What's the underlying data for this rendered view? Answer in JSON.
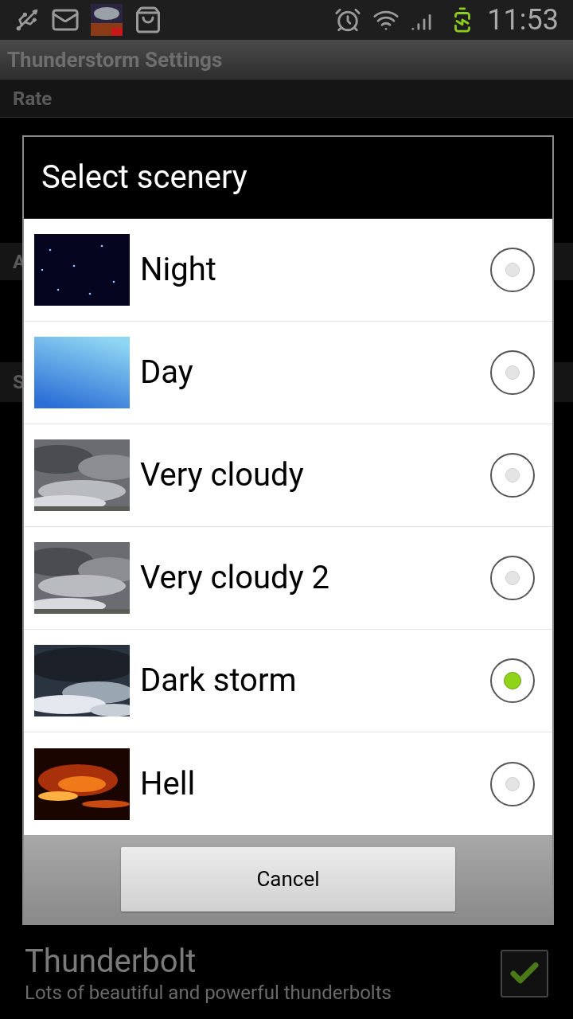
{
  "status_bar": {
    "time": "11:53"
  },
  "app_bar": {
    "title": "Thunderstorm Settings"
  },
  "background": {
    "rate_header": "Rate",
    "category_a": "A",
    "category_s": "S",
    "thunderbolt": {
      "title": "Thunderbolt",
      "summary": "Lots of beautiful and powerful thunderbolts",
      "checked": true
    }
  },
  "dialog": {
    "title": "Select scenery",
    "items": [
      {
        "label": "Night",
        "selected": false
      },
      {
        "label": "Day",
        "selected": false
      },
      {
        "label": "Very cloudy",
        "selected": false
      },
      {
        "label": "Very cloudy 2",
        "selected": false
      },
      {
        "label": "Dark storm",
        "selected": true
      },
      {
        "label": "Hell",
        "selected": false
      }
    ],
    "button": "Cancel"
  }
}
